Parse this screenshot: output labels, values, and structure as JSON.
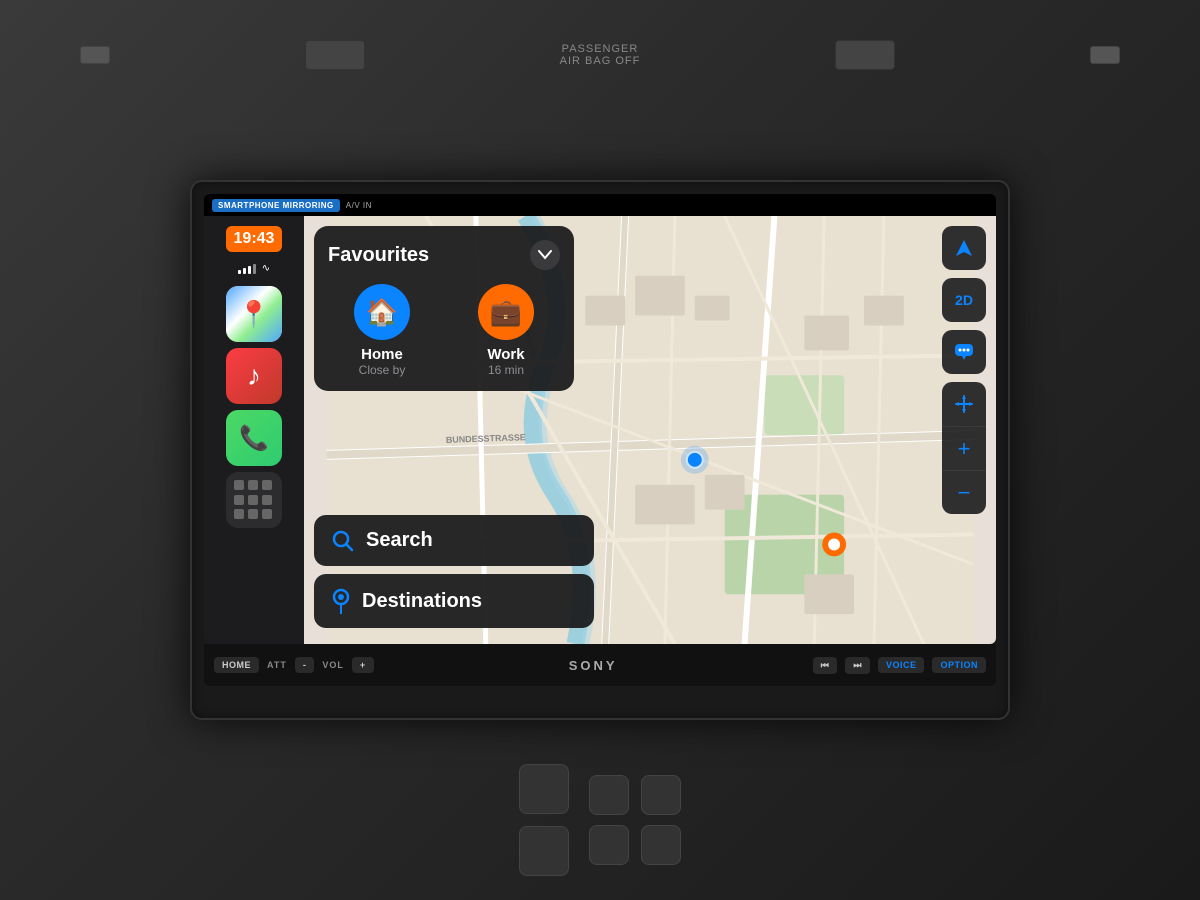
{
  "screen": {
    "status_bar": {
      "mirroring_label": "SMARTPHONE MIRRORING",
      "av_label": "A/V IN"
    },
    "sidebar": {
      "time": "19:43",
      "apps": [
        {
          "name": "Maps",
          "icon": "🗺"
        },
        {
          "name": "Music",
          "icon": "♪"
        },
        {
          "name": "Phone",
          "icon": "📞"
        },
        {
          "name": "Home",
          "icon": "⊞"
        }
      ]
    },
    "favourites_card": {
      "title": "Favourites",
      "items": [
        {
          "label": "Home",
          "sublabel": "Close by",
          "icon": "🏠"
        },
        {
          "label": "Work",
          "sublabel": "16 min",
          "icon": "💼"
        }
      ]
    },
    "buttons": [
      {
        "id": "search",
        "label": "Search",
        "icon": "🔍"
      },
      {
        "id": "destinations",
        "label": "Destinations",
        "icon": "📍"
      }
    ],
    "map_controls": [
      {
        "id": "location",
        "icon": "➤"
      },
      {
        "id": "2d",
        "label": "2D"
      },
      {
        "id": "traffic",
        "icon": "💬"
      },
      {
        "id": "pan",
        "icon": "✛"
      },
      {
        "id": "zoom_in",
        "label": "+"
      },
      {
        "id": "zoom_out",
        "label": "−"
      }
    ]
  },
  "control_bar": {
    "buttons": [
      {
        "label": "HOME"
      },
      {
        "label": "ATT"
      },
      {
        "label": "-"
      },
      {
        "label": "VOL"
      },
      {
        "label": "+"
      }
    ],
    "brand": "SONY",
    "right_buttons": [
      {
        "label": "⏮"
      },
      {
        "label": "⏭"
      },
      {
        "label": "VOICE"
      },
      {
        "label": "OPTION"
      }
    ]
  },
  "airbag_text": "PASSENGER\nAIR BAG OFF"
}
